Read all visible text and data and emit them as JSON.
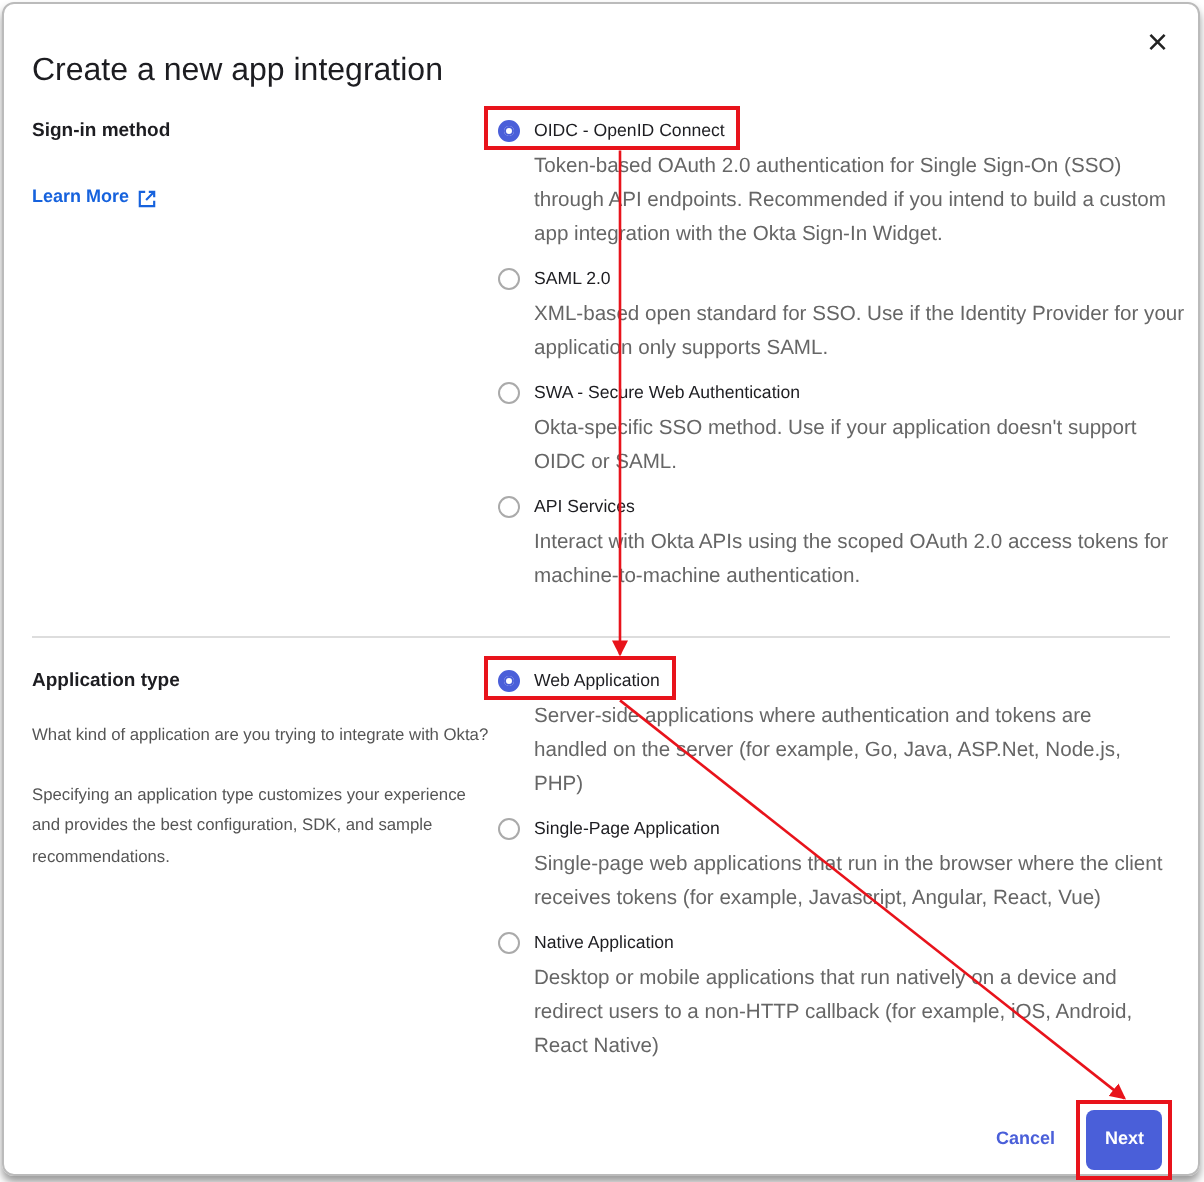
{
  "dialog": {
    "title": "Create a new app integration",
    "close": "×"
  },
  "sections": [
    {
      "heading": "Sign-in method",
      "link": "Learn More",
      "options": [
        {
          "label": "OIDC - OpenID Connect",
          "description": "Token-based OAuth 2.0 authentication for Single Sign-On (SSO) through API endpoints. Recommended if you intend to build a custom app integration with the Okta Sign-In Widget.",
          "selected": true,
          "highlighted": true
        },
        {
          "label": "SAML 2.0",
          "description": "XML-based open standard for SSO. Use if the Identity Provider for your application only supports SAML.",
          "selected": false
        },
        {
          "label": "SWA - Secure Web Authentication",
          "description": "Okta-specific SSO method. Use if your application doesn't support OIDC or SAML.",
          "selected": false
        },
        {
          "label": "API Services",
          "description": "Interact with Okta APIs using the scoped OAuth 2.0 access tokens for machine-to-machine authentication.",
          "selected": false
        }
      ]
    },
    {
      "heading": "Application type",
      "paragraphs": [
        "What kind of application are you trying to integrate with Okta?",
        "Specifying an application type customizes your experience and provides the best configuration, SDK, and sample recommendations."
      ],
      "options": [
        {
          "label": "Web Application",
          "description": "Server-side applications where authentication and tokens are handled on the server (for example, Go, Java, ASP.Net, Node.js, PHP)",
          "selected": true,
          "highlighted": true
        },
        {
          "label": "Single-Page Application",
          "description": "Single-page web applications that run in the browser where the client receives tokens (for example, Javascript, Angular, React, Vue)",
          "selected": false
        },
        {
          "label": "Native Application",
          "description": "Desktop or mobile applications that run natively on a device and redirect users to a non-HTTP callback (for example, iOS, Android, React Native)",
          "selected": false
        }
      ]
    }
  ],
  "buttons": [
    {
      "label": "Cancel",
      "kind": "link"
    },
    {
      "label": "Next",
      "kind": "primary",
      "highlighted": true
    }
  ]
}
